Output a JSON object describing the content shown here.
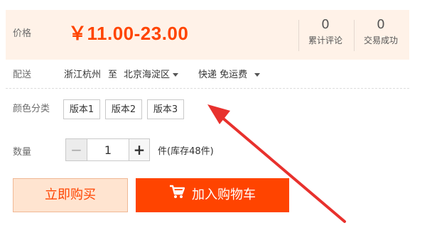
{
  "price_row": {
    "label": "价格",
    "price": "￥11.00-23.00"
  },
  "stats": [
    {
      "count": "0",
      "label": "累计评论"
    },
    {
      "count": "0",
      "label": "交易成功"
    }
  ],
  "shipping": {
    "label": "配送",
    "from": "浙江杭州",
    "to_word": "至",
    "destination": "北京海淀区",
    "method": "快递 免运费"
  },
  "variants": {
    "label": "颜色分类",
    "options": [
      "版本1",
      "版本2",
      "版本3"
    ]
  },
  "quantity": {
    "label": "数量",
    "minus": "−",
    "value": "1",
    "plus": "+",
    "stock_text": "件(库存48件)"
  },
  "actions": {
    "buy_now": "立即购买",
    "add_to_cart": "加入购物车"
  },
  "colors": {
    "accent": "#ff4400",
    "annotation_arrow": "#e8312d"
  }
}
